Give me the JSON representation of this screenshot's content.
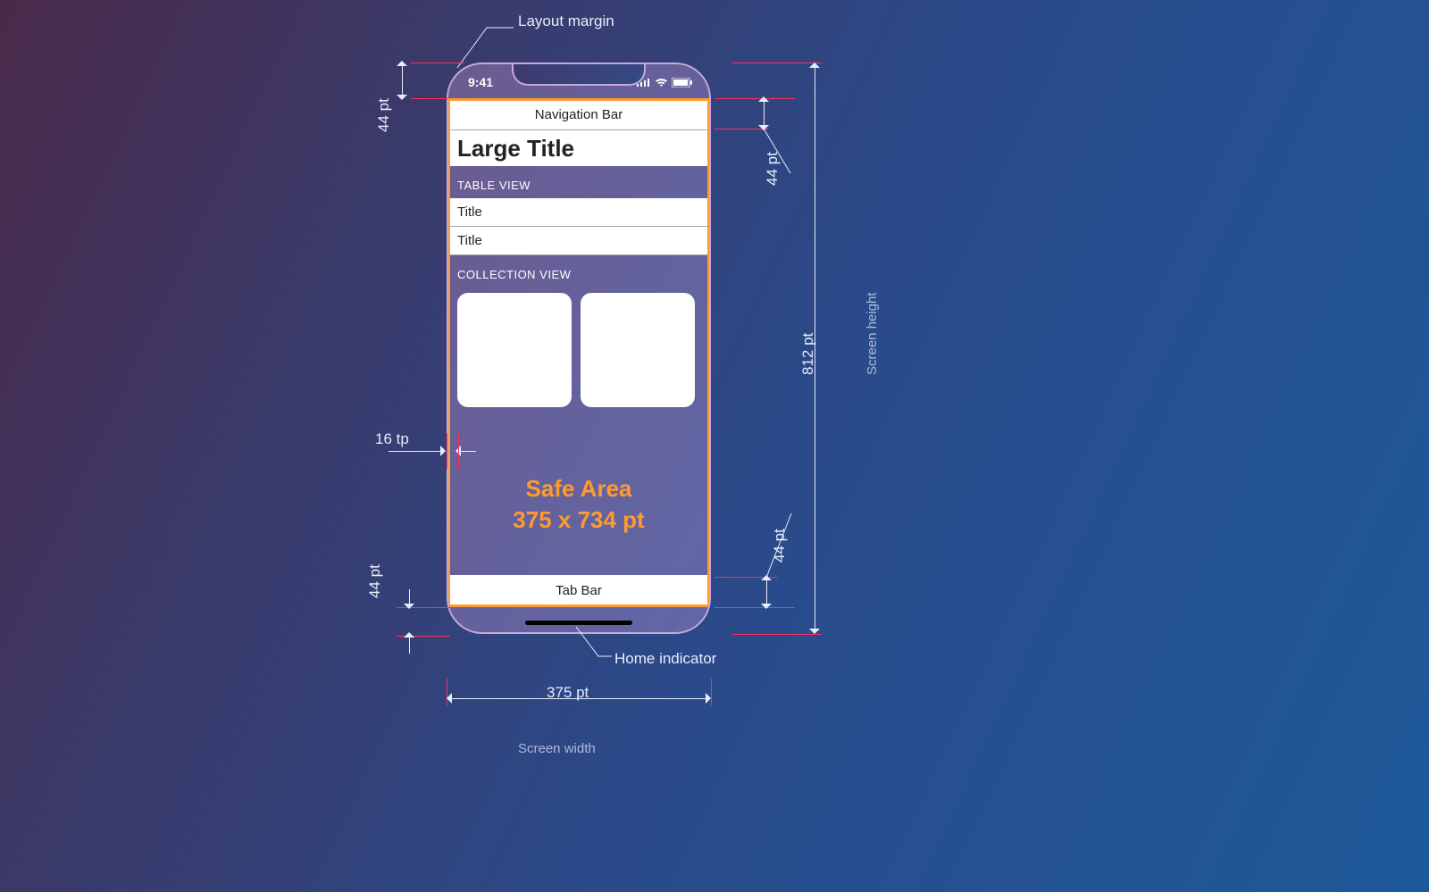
{
  "callouts": {
    "layout_margin": "Layout margin",
    "home_indicator": "Home indicator",
    "screen_width": "Screen width",
    "screen_height": "Screen height"
  },
  "measurements": {
    "status_height": "44 pt",
    "navbar_height": "44 pt",
    "tabbar_height": "44 pt",
    "left_margin_label": "44 pt",
    "side_margin": "16 tp",
    "screen_height_value": "812 pt",
    "screen_width_value": "375 pt"
  },
  "phone": {
    "status_time": "9:41",
    "navigation_bar": "Navigation Bar",
    "large_title": "Large Title",
    "table_header": "TABLE VIEW",
    "table_rows": [
      "Title",
      "Title"
    ],
    "collection_header": "COLLECTION VIEW",
    "safe_area_line1": "Safe Area",
    "safe_area_line2": "375 x 734 pt",
    "tab_bar": "Tab Bar"
  }
}
